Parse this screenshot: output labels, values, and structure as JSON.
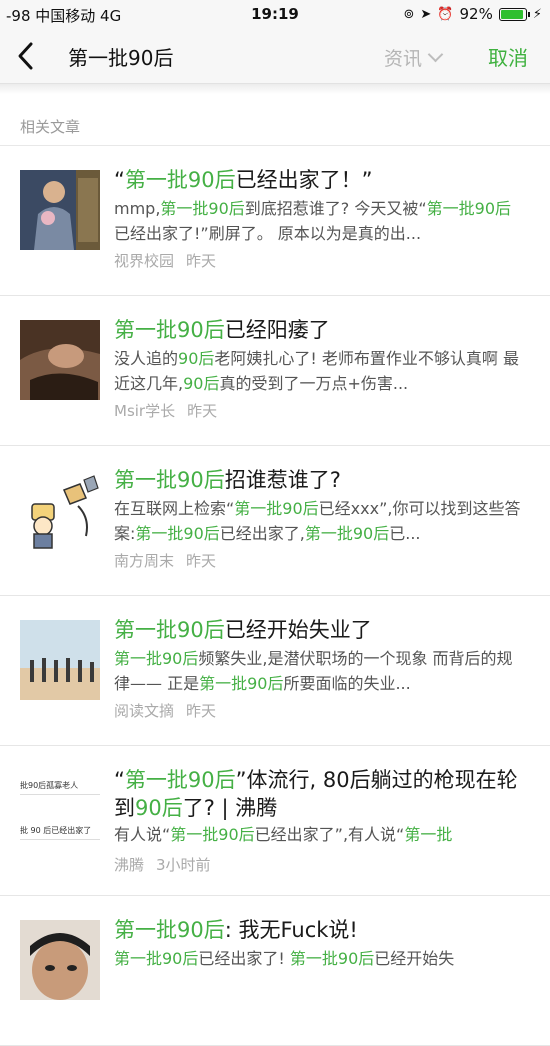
{
  "status_bar": {
    "carrier": "-98 中国移动  4G",
    "time": "19:19",
    "battery_text": "92%",
    "battery_level": 0.92,
    "icons": [
      "rotation-lock-icon",
      "location-arrow-icon",
      "alarm-icon",
      "charging-bolt-icon"
    ]
  },
  "nav": {
    "back_icon": "chevron-left-icon",
    "query": "第一批90后",
    "filter_label": "资讯",
    "cancel_label": "取消"
  },
  "section": {
    "header": "相关文章"
  },
  "colors": {
    "highlight": "#45b045",
    "cancel": "#3fb13f",
    "meta": "#aaaaaa"
  },
  "articles": [
    {
      "title": [
        {
          "t": "“"
        },
        {
          "t": "第一批90后",
          "h": true
        },
        {
          "t": "已经出家了！”"
        }
      ],
      "snippet": [
        {
          "t": "mmp,"
        },
        {
          "t": "第一批90后",
          "h": true
        },
        {
          "t": "到底招惹谁了? 今天又被“"
        },
        {
          "t": "第一批90后",
          "h": true
        },
        {
          "t": "已经出家了!”刷屏了。 原本以为是真的出..."
        }
      ],
      "source": "视界校园",
      "time": "昨天",
      "thumb": "monk-photo"
    },
    {
      "title": [
        {
          "t": "第一批90后",
          "h": true
        },
        {
          "t": "已经阳痿了"
        }
      ],
      "snippet": [
        {
          "t": "没人追的"
        },
        {
          "t": "90后",
          "h": true
        },
        {
          "t": "老阿姨扎心了! 老师布置作业不够认真啊 最近这几年,"
        },
        {
          "t": "90后",
          "h": true
        },
        {
          "t": "真的受到了一万点+伤害..."
        }
      ],
      "source": "Msir学长",
      "time": "昨天",
      "thumb": "couple-photo"
    },
    {
      "title": [
        {
          "t": "第一批90后",
          "h": true
        },
        {
          "t": "招谁惹谁了?"
        }
      ],
      "snippet": [
        {
          "t": "在互联网上检索“"
        },
        {
          "t": "第一批90后",
          "h": true
        },
        {
          "t": "已经xxx”,你可以找到这些答案:"
        },
        {
          "t": "第一批90后",
          "h": true
        },
        {
          "t": "已经出家了,"
        },
        {
          "t": "第一批90后",
          "h": true
        },
        {
          "t": "已..."
        }
      ],
      "source": "南方周末",
      "time": "昨天",
      "thumb": "cartoon-illustration"
    },
    {
      "title": [
        {
          "t": "第一批90后",
          "h": true
        },
        {
          "t": "已经开始失业了"
        }
      ],
      "snippet": [
        {
          "t": "第一批90后",
          "h": true
        },
        {
          "t": "频繁失业,是潜伏职场的一个现象 而背后的规律—— 正是"
        },
        {
          "t": "第一批90后",
          "h": true
        },
        {
          "t": "所要面临的失业..."
        }
      ],
      "source": "阅读文摘",
      "time": "昨天",
      "thumb": "beach-group-photo"
    },
    {
      "two_line": true,
      "title": [
        {
          "t": "“"
        },
        {
          "t": "第一批90后",
          "h": true
        },
        {
          "t": "”体流行, 80后躺过的枪现在轮到"
        },
        {
          "t": "90后",
          "h": true
        },
        {
          "t": "了? | 沸腾"
        }
      ],
      "snippet": [
        {
          "t": "有人说“"
        },
        {
          "t": "第一批90后",
          "h": true
        },
        {
          "t": "已经出家了”,有人说“"
        },
        {
          "t": "第一批",
          "h": true
        }
      ],
      "source": "沸腾",
      "time": "3小时前",
      "thumb": "text-screenshot",
      "thumb_lines": [
        "批90后孤寡老人",
        "批 90 后已经出家了"
      ]
    },
    {
      "title": [
        {
          "t": "第一批90后",
          "h": true
        },
        {
          "t": ": 我无Fuck说!"
        }
      ],
      "snippet": [
        {
          "t": "第一批90后",
          "h": true
        },
        {
          "t": "已经出家了! "
        },
        {
          "t": "第一批90后",
          "h": true
        },
        {
          "t": "已经开始失"
        }
      ],
      "source": "",
      "time": "",
      "thumb": "face-photo"
    }
  ]
}
